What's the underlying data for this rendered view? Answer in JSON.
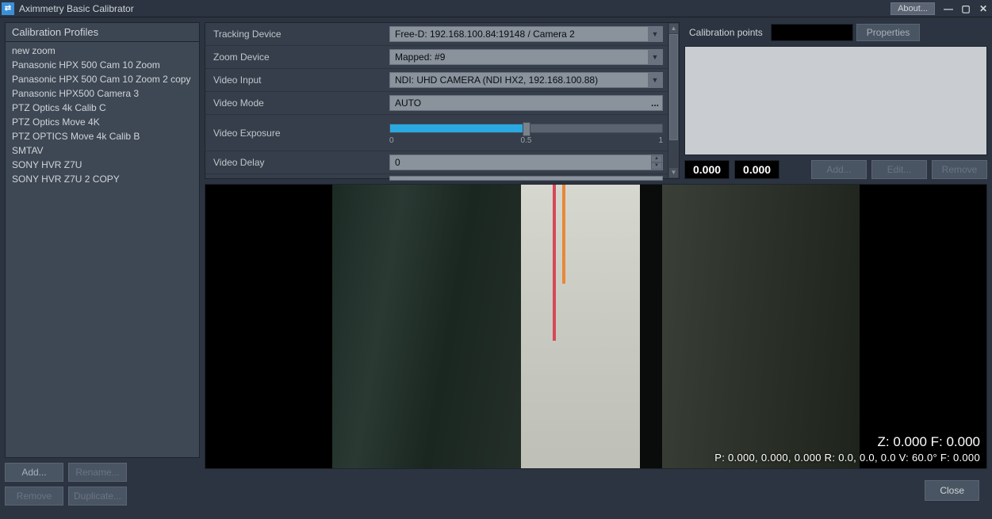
{
  "titlebar": {
    "title": "Aximmetry Basic Calibrator",
    "about": "About..."
  },
  "profiles": {
    "header": "Calibration Profiles",
    "items": [
      "new zoom",
      "Panasonic HPX 500 Cam 10 Zoom",
      "Panasonic HPX 500 Cam 10 Zoom 2 copy",
      "Panasonic HPX500 Camera 3",
      "PTZ Optics 4k Calib C",
      "PTZ Optics Move 4K",
      "PTZ OPTICS Move 4k Calib B",
      "SMTAV",
      "SONY HVR Z7U",
      "SONY HVR Z7U 2 COPY"
    ],
    "buttons": {
      "add": "Add...",
      "rename": "Rename...",
      "remove": "Remove",
      "duplicate": "Duplicate..."
    }
  },
  "settings": {
    "tracking_label": "Tracking Device",
    "tracking_value": "Free-D: 192.168.100.84:19148 / Camera 2",
    "zoom_label": "Zoom Device",
    "zoom_value": "Mapped: #9",
    "video_input_label": "Video Input",
    "video_input_value": "NDI: UHD CAMERA (NDI HX2, 192.168.100.88)",
    "video_mode_label": "Video Mode",
    "video_mode_value": "AUTO",
    "exposure_label": "Video Exposure",
    "exposure_ticks": {
      "t0": "0",
      "t1": "0.5",
      "t2": "1"
    },
    "delay_label": "Video Delay",
    "delay_value": "0"
  },
  "calib": {
    "header": "Calibration points",
    "properties": "Properties",
    "coord1": "0.000",
    "coord2": "0.000",
    "add": "Add...",
    "edit": "Edit...",
    "remove": "Remove"
  },
  "preview": {
    "line1": "Z: 0.000  F: 0.000",
    "line2": "P: 0.000, 0.000, 0.000     R: 0.0, 0.0, 0.0     V: 60.0°     F: 0.000"
  },
  "footer": {
    "close": "Close"
  }
}
